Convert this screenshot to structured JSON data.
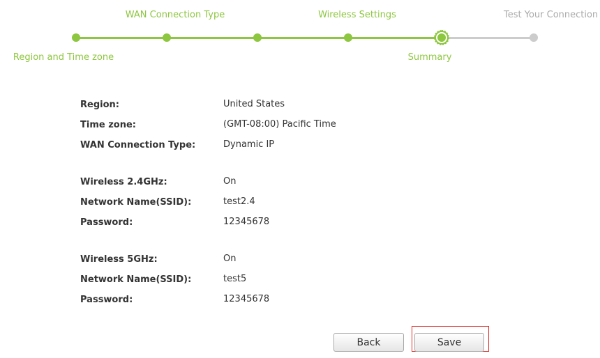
{
  "stepper": {
    "steps": [
      {
        "label": "Region and Time zone",
        "state": "done"
      },
      {
        "label": "WAN Connection Type",
        "state": "done"
      },
      {
        "label": "",
        "state": "done"
      },
      {
        "label": "Wireless Settings",
        "state": "done"
      },
      {
        "label": "Summary",
        "state": "current"
      },
      {
        "label": "Test Your Connection",
        "state": "todo"
      }
    ],
    "accent_color": "#8dc63f",
    "inactive_color": "#cccccc"
  },
  "summary": {
    "region_label": "Region:",
    "region_value": "United States",
    "timezone_label": "Time zone:",
    "timezone_value": "(GMT-08:00) Pacific Time",
    "wan_label": "WAN Connection Type:",
    "wan_value": "Dynamic IP",
    "w24_label": "Wireless 2.4GHz:",
    "w24_value": "On",
    "w24_ssid_label": "Network Name(SSID):",
    "w24_ssid_value": "test2.4",
    "w24_pass_label": "Password:",
    "w24_pass_value": "12345678",
    "w5_label": "Wireless 5GHz:",
    "w5_value": "On",
    "w5_ssid_label": "Network Name(SSID):",
    "w5_ssid_value": "test5",
    "w5_pass_label": "Password:",
    "w5_pass_value": "12345678"
  },
  "buttons": {
    "back_label": "Back",
    "save_label": "Save"
  }
}
